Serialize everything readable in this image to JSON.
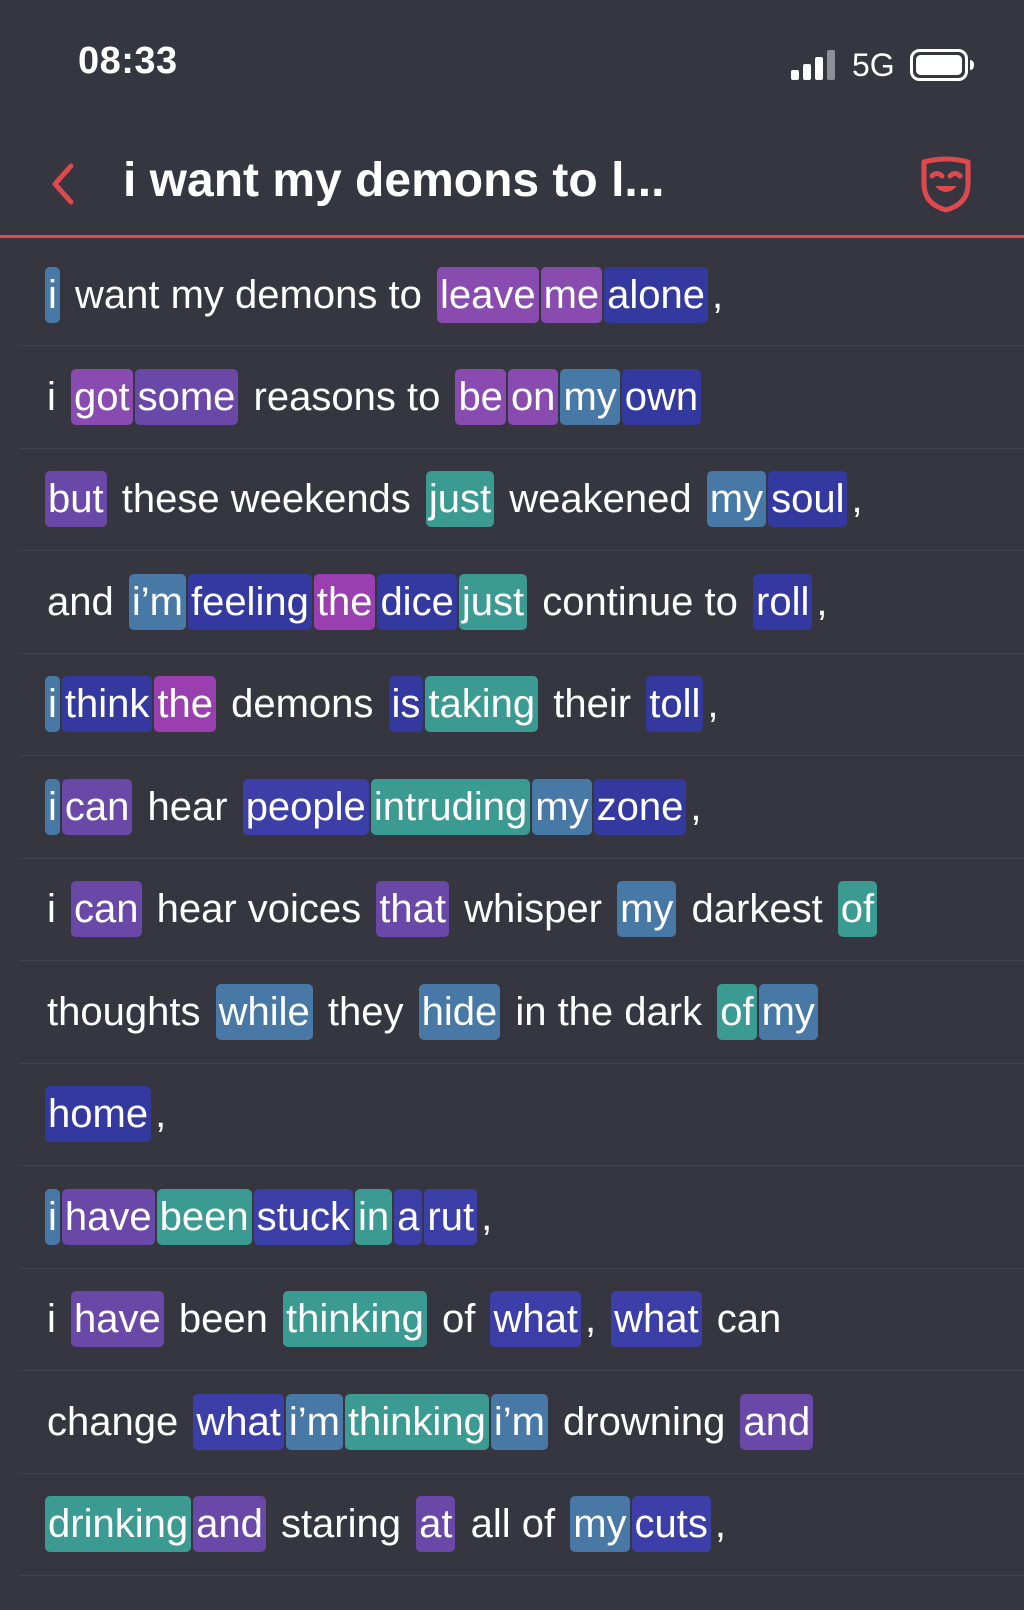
{
  "status_bar": {
    "time": "08:33",
    "network": "5G",
    "icons": [
      "signal-icon",
      "battery-icon"
    ]
  },
  "header": {
    "title": "i want my demons to l...",
    "back_icon": "chevron-left-icon",
    "action_icon": "theater-mask-icon",
    "accent_color": "#e0484d"
  },
  "colors": {
    "background": "#363641",
    "divider": "#43434f",
    "purple": "#8a4bb0",
    "violet": "#6a48a8",
    "indigo": "#3d3fa8",
    "navy": "#34399f",
    "steel": "#4878a6",
    "teal": "#3b9a92",
    "magenta": "#9a3fb0"
  },
  "lyrics": [
    {
      "segments": [
        {
          "text": "i",
          "hl": "steel"
        },
        {
          "text": " want my demons to ",
          "hl": null
        },
        {
          "text": "leave",
          "hl": "purple"
        },
        {
          "text": "me",
          "hl": "purple"
        },
        {
          "text": "alone",
          "hl": "navy"
        },
        {
          "text": ",",
          "hl": null
        }
      ]
    },
    {
      "segments": [
        {
          "text": "i ",
          "hl": null
        },
        {
          "text": "got",
          "hl": "purple"
        },
        {
          "text": "some",
          "hl": "violet"
        },
        {
          "text": " reasons to ",
          "hl": null
        },
        {
          "text": "be",
          "hl": "purple"
        },
        {
          "text": "on",
          "hl": "purple"
        },
        {
          "text": "my",
          "hl": "steel"
        },
        {
          "text": "own",
          "hl": "navy"
        }
      ]
    },
    {
      "segments": [
        {
          "text": "but",
          "hl": "violet"
        },
        {
          "text": " these weekends ",
          "hl": null
        },
        {
          "text": "just",
          "hl": "teal"
        },
        {
          "text": " weakened ",
          "hl": null
        },
        {
          "text": "my",
          "hl": "steel"
        },
        {
          "text": "soul",
          "hl": "navy"
        },
        {
          "text": ",",
          "hl": null
        }
      ]
    },
    {
      "segments": [
        {
          "text": "and ",
          "hl": null
        },
        {
          "text": "i’m",
          "hl": "steel"
        },
        {
          "text": "feeling",
          "hl": "navy"
        },
        {
          "text": "the",
          "hl": "magenta"
        },
        {
          "text": "dice",
          "hl": "navy"
        },
        {
          "text": "just",
          "hl": "teal"
        },
        {
          "text": " continue to ",
          "hl": null
        },
        {
          "text": "roll",
          "hl": "navy"
        },
        {
          "text": ",",
          "hl": null
        }
      ]
    },
    {
      "segments": [
        {
          "text": "i",
          "hl": "steel"
        },
        {
          "text": "think",
          "hl": "navy"
        },
        {
          "text": "the",
          "hl": "magenta"
        },
        {
          "text": " demons ",
          "hl": null
        },
        {
          "text": "is",
          "hl": "navy"
        },
        {
          "text": "taking",
          "hl": "teal"
        },
        {
          "text": " their ",
          "hl": null
        },
        {
          "text": "toll",
          "hl": "navy"
        },
        {
          "text": ",",
          "hl": null
        }
      ]
    },
    {
      "segments": [
        {
          "text": "i",
          "hl": "steel"
        },
        {
          "text": "can",
          "hl": "violet"
        },
        {
          "text": " hear ",
          "hl": null
        },
        {
          "text": "people",
          "hl": "indigo"
        },
        {
          "text": "intruding",
          "hl": "teal"
        },
        {
          "text": "my",
          "hl": "steel"
        },
        {
          "text": "zone",
          "hl": "navy"
        },
        {
          "text": ",",
          "hl": null
        }
      ]
    },
    {
      "segments": [
        {
          "text": "i ",
          "hl": null
        },
        {
          "text": "can",
          "hl": "violet"
        },
        {
          "text": " hear voices ",
          "hl": null
        },
        {
          "text": "that",
          "hl": "violet"
        },
        {
          "text": " whisper ",
          "hl": null
        },
        {
          "text": "my",
          "hl": "steel"
        },
        {
          "text": " darkest ",
          "hl": null
        },
        {
          "text": "of",
          "hl": "teal"
        }
      ]
    },
    {
      "segments": [
        {
          "text": "thoughts ",
          "hl": null
        },
        {
          "text": "while",
          "hl": "steel"
        },
        {
          "text": " they ",
          "hl": null
        },
        {
          "text": "hide",
          "hl": "steel"
        },
        {
          "text": " in the dark ",
          "hl": null
        },
        {
          "text": "of",
          "hl": "teal"
        },
        {
          "text": "my",
          "hl": "steel"
        }
      ]
    },
    {
      "segments": [
        {
          "text": "home",
          "hl": "navy"
        },
        {
          "text": ",",
          "hl": null
        }
      ]
    },
    {
      "segments": [
        {
          "text": "i",
          "hl": "steel"
        },
        {
          "text": "have",
          "hl": "violet"
        },
        {
          "text": "been",
          "hl": "teal"
        },
        {
          "text": "stuck",
          "hl": "indigo"
        },
        {
          "text": "in",
          "hl": "teal"
        },
        {
          "text": "a",
          "hl": "indigo"
        },
        {
          "text": "rut",
          "hl": "indigo"
        },
        {
          "text": ",",
          "hl": null
        }
      ]
    },
    {
      "segments": [
        {
          "text": "i ",
          "hl": null
        },
        {
          "text": "have",
          "hl": "violet"
        },
        {
          "text": " been ",
          "hl": null
        },
        {
          "text": "thinking",
          "hl": "teal"
        },
        {
          "text": " of ",
          "hl": null
        },
        {
          "text": "what",
          "hl": "indigo"
        },
        {
          "text": ", ",
          "hl": null
        },
        {
          "text": "what",
          "hl": "indigo"
        },
        {
          "text": " can",
          "hl": null
        }
      ]
    },
    {
      "segments": [
        {
          "text": "change ",
          "hl": null
        },
        {
          "text": "what",
          "hl": "indigo"
        },
        {
          "text": "i’m",
          "hl": "steel"
        },
        {
          "text": "thinking",
          "hl": "teal"
        },
        {
          "text": "i’m",
          "hl": "steel"
        },
        {
          "text": " drowning ",
          "hl": null
        },
        {
          "text": "and",
          "hl": "violet"
        }
      ]
    },
    {
      "segments": [
        {
          "text": "drinking",
          "hl": "teal"
        },
        {
          "text": "and",
          "hl": "violet"
        },
        {
          "text": " staring ",
          "hl": null
        },
        {
          "text": "at",
          "hl": "violet"
        },
        {
          "text": " all of ",
          "hl": null
        },
        {
          "text": "my",
          "hl": "steel"
        },
        {
          "text": "cuts",
          "hl": "indigo"
        },
        {
          "text": ",",
          "hl": null
        }
      ]
    }
  ]
}
